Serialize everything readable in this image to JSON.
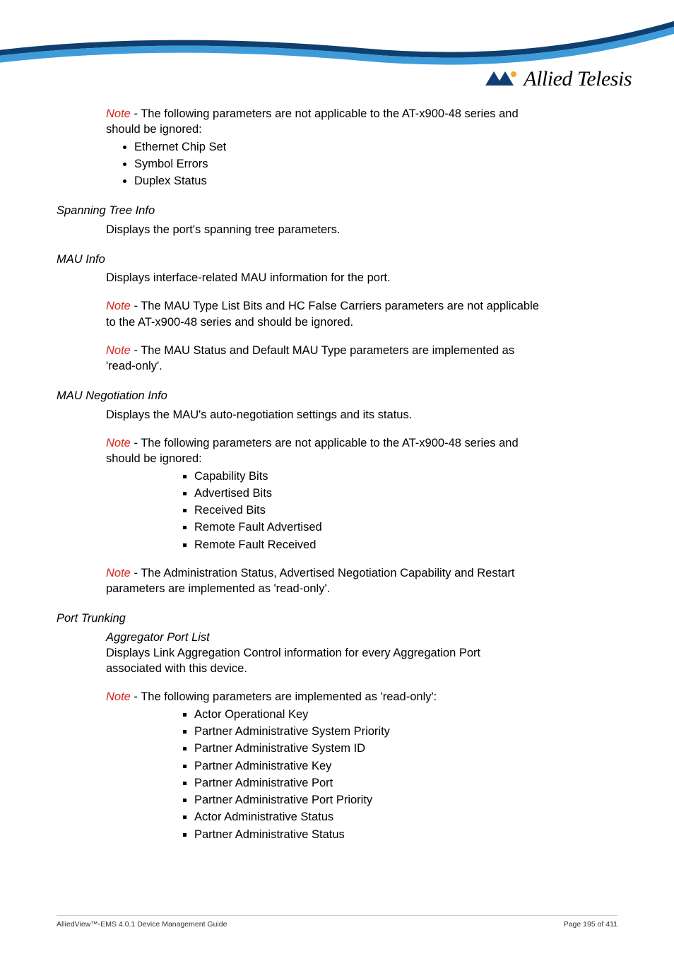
{
  "logo": {
    "brand": "Allied Telesis"
  },
  "note_label": "Note",
  "p1": {
    "note_line1": " - The following parameters are not applicable to the AT-x900-48 series and",
    "note_line2": "should be ignored:",
    "bullets": [
      "Ethernet Chip Set",
      "Symbol Errors",
      "Duplex Status"
    ]
  },
  "spanning": {
    "heading": "Spanning Tree Info",
    "line": "Displays the port's spanning tree parameters."
  },
  "mau_info": {
    "heading": "MAU Info",
    "line": "Displays interface-related MAU information for the port.",
    "note1_line1": " - The MAU Type List Bits and HC False Carriers parameters are not applicable",
    "note1_line2": "to the AT-x900-48 series and should be ignored.",
    "note2_line1": " - The MAU Status and Default MAU Type parameters are implemented as",
    "note2_line2": "'read-only'."
  },
  "mau_neg": {
    "heading": "MAU Negotiation Info",
    "line": "Displays the MAU's auto-negotiation settings and its status.",
    "note1_line1": " - The following parameters are not applicable to the AT-x900-48 series and",
    "note1_line2": "should be ignored:",
    "bullets": [
      "Capability Bits",
      "Advertised Bits",
      "Received Bits",
      "Remote Fault Advertised",
      "Remote Fault Received"
    ],
    "note2_line1": " - The Administration Status, Advertised Negotiation Capability and Restart",
    "note2_line2": "parameters are implemented as 'read-only'."
  },
  "port_trunk": {
    "heading": "Port Trunking",
    "sub": "Aggregator Port List",
    "line1": "Displays Link Aggregation Control information for every Aggregation Port",
    "line2": "associated with this device.",
    "note_line": " - The following parameters are implemented as 'read-only':",
    "bullets": [
      "Actor Operational Key",
      "Partner Administrative System Priority",
      "Partner Administrative System ID",
      "Partner Administrative Key",
      "Partner Administrative Port",
      "Partner Administrative Port Priority",
      "Actor Administrative Status",
      "Partner Administrative Status"
    ]
  },
  "footer": {
    "left": "AlliedView™-EMS 4.0.1 Device Management Guide",
    "right": "Page 195 of 411"
  }
}
